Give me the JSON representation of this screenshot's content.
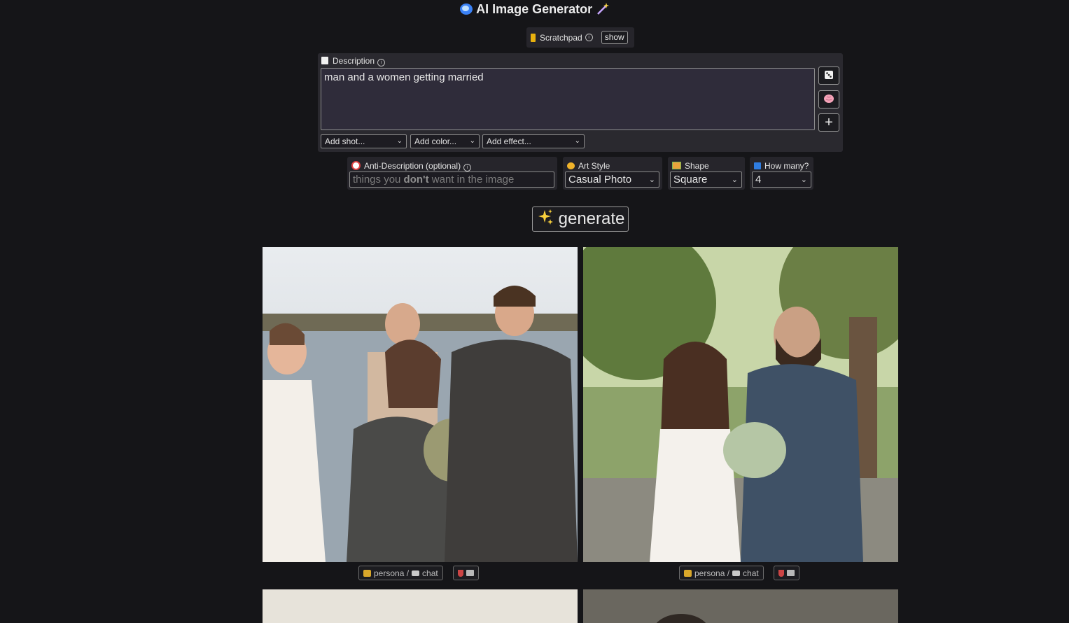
{
  "header": {
    "title": "AI Image Generator",
    "logo_icon": "blue-gem-icon",
    "wand_icon": "magic-wand-icon"
  },
  "scratchpad": {
    "label": "Scratchpad",
    "show_label": "show"
  },
  "description": {
    "label": "Description",
    "value": "man and a women getting married",
    "side_buttons": [
      "dice-icon",
      "brain-icon",
      "plus-icon"
    ]
  },
  "dropdowns": {
    "shot": "Add shot...",
    "color": "Add color...",
    "effect": "Add effect..."
  },
  "anti_description": {
    "label": "Anti-Description (optional)",
    "placeholder_pre": "things you ",
    "placeholder_bold": "don't",
    "placeholder_post": " want in the image"
  },
  "art_style": {
    "label": "Art Style",
    "value": "Casual Photo"
  },
  "shape": {
    "label": "Shape",
    "value": "Square"
  },
  "how_many": {
    "label": "How many?",
    "value": "4"
  },
  "generate": {
    "label": "generate"
  },
  "results": [
    {
      "persona": "persona /",
      "chat": "chat",
      "alt": "wedding ceremony by a lake"
    },
    {
      "persona": "persona /",
      "chat": "chat",
      "alt": "bride and groom smiling outdoors"
    }
  ]
}
